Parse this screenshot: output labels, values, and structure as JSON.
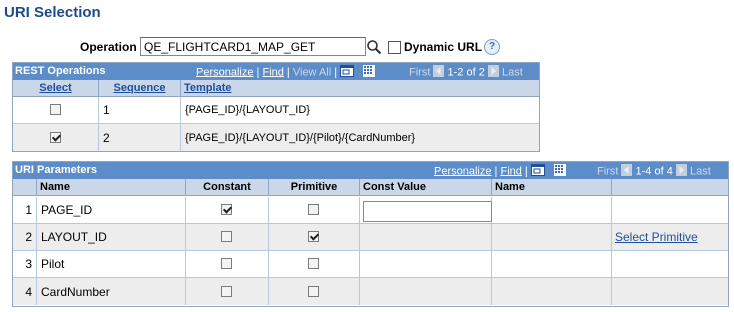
{
  "page": {
    "title": "URI Selection"
  },
  "operation": {
    "label": "Operation",
    "value": "QE_FLIGHTCARD1_MAP_GET",
    "lookup_icon": "magnifier-icon",
    "dynamic_url_label": "Dynamic URL",
    "dynamic_url_checked": false,
    "help_icon": "help-icon",
    "help_glyph": "?"
  },
  "rest_operations": {
    "title": "REST Operations",
    "personalize": "Personalize",
    "find": "Find",
    "view_all": "View All",
    "first": "First",
    "range": "1-2 of 2",
    "last": "Last",
    "columns": [
      "Select",
      "Sequence",
      "Template"
    ],
    "rows": [
      {
        "selected": false,
        "sequence": "1",
        "template": "{PAGE_ID}/{LAYOUT_ID}"
      },
      {
        "selected": true,
        "sequence": "2",
        "template": "{PAGE_ID}/{LAYOUT_ID}/{Pilot}/{CardNumber}"
      }
    ]
  },
  "uri_parameters": {
    "title": "URI Parameters",
    "personalize": "Personalize",
    "find": "Find",
    "first": "First",
    "range": "1-4 of 4",
    "last": "Last",
    "columns": [
      "Name",
      "Constant",
      "Primitive",
      "Const Value",
      "Name",
      ""
    ],
    "rows": [
      {
        "num": "1",
        "name": "PAGE_ID",
        "constant": true,
        "primitive": false,
        "const_value": "",
        "has_input": true,
        "action": ""
      },
      {
        "num": "2",
        "name": "LAYOUT_ID",
        "constant": false,
        "primitive": true,
        "const_value": "",
        "has_input": false,
        "action": "Select Primitive"
      },
      {
        "num": "3",
        "name": "Pilot",
        "constant": false,
        "primitive": false,
        "const_value": "",
        "has_input": false,
        "action": ""
      },
      {
        "num": "4",
        "name": "CardNumber",
        "constant": false,
        "primitive": false,
        "const_value": "",
        "has_input": false,
        "action": ""
      }
    ]
  },
  "colors": {
    "grid_header": "#5d8dc8",
    "col_header": "#cad7e8",
    "row_alt": "#ededed",
    "title": "#1c4b8c",
    "link": "#1f4f9a"
  }
}
